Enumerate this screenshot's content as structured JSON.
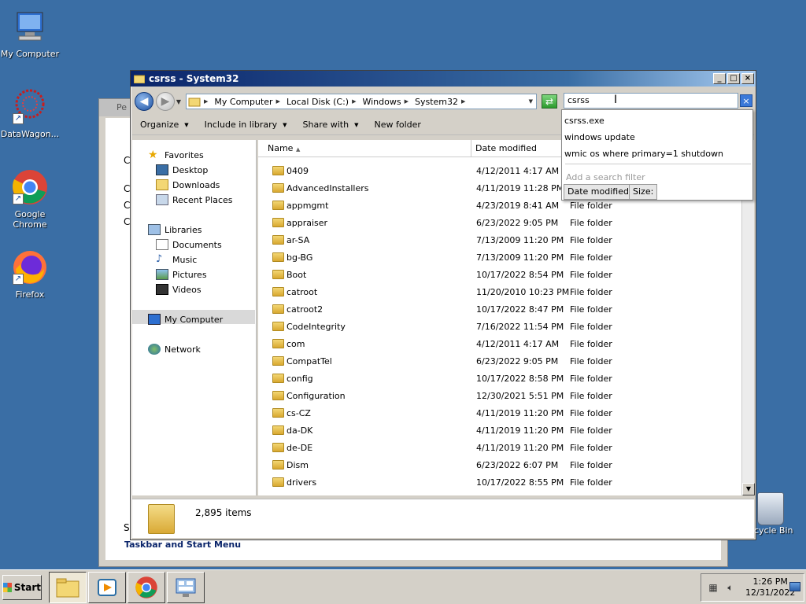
{
  "desktop": {
    "icons": [
      {
        "label": "My Computer"
      },
      {
        "label": "DataWagon..."
      },
      {
        "label": "Google Chrome"
      },
      {
        "label": "Firefox"
      }
    ],
    "recycle_bin_label": "cycle Bin"
  },
  "background_window": {
    "title_fragment": "Pe",
    "link_text": "Taskbar and Start Menu",
    "fragments": [
      "C",
      "C",
      "C",
      "C",
      "S"
    ]
  },
  "window": {
    "title": "csrss - System32",
    "breadcrumb": [
      "My Computer",
      "Local Disk (C:)",
      "Windows",
      "System32"
    ],
    "search": {
      "value": "csrss",
      "suggestions": [
        "csrss.exe",
        "windows update",
        "wmic os where primary=1 shutdown"
      ],
      "filter_placeholder": "Add a search filter",
      "filters": [
        "Date modified:",
        "Size:"
      ]
    },
    "toolbar": {
      "organize": "Organize",
      "include_in_library": "Include in library",
      "share_with": "Share with",
      "new_folder": "New folder"
    },
    "nav": {
      "favorites": "Favorites",
      "favorites_items": [
        "Desktop",
        "Downloads",
        "Recent Places"
      ],
      "libraries": "Libraries",
      "libraries_items": [
        "Documents",
        "Music",
        "Pictures",
        "Videos"
      ],
      "computer": "My Computer",
      "network": "Network"
    },
    "columns": {
      "name": "Name",
      "date": "Date modified"
    },
    "files": [
      {
        "name": "0409",
        "date": "4/12/2011 4:17 AM",
        "type": ""
      },
      {
        "name": "AdvancedInstallers",
        "date": "4/11/2019 11:28 PM",
        "type": ""
      },
      {
        "name": "appmgmt",
        "date": "4/23/2019 8:41 AM",
        "type": "File folder"
      },
      {
        "name": "appraiser",
        "date": "6/23/2022 9:05 PM",
        "type": "File folder"
      },
      {
        "name": "ar-SA",
        "date": "7/13/2009 11:20 PM",
        "type": "File folder"
      },
      {
        "name": "bg-BG",
        "date": "7/13/2009 11:20 PM",
        "type": "File folder"
      },
      {
        "name": "Boot",
        "date": "10/17/2022 8:54 PM",
        "type": "File folder"
      },
      {
        "name": "catroot",
        "date": "11/20/2010 10:23 PM",
        "type": "File folder"
      },
      {
        "name": "catroot2",
        "date": "10/17/2022 8:47 PM",
        "type": "File folder"
      },
      {
        "name": "CodeIntegrity",
        "date": "7/16/2022 11:54 PM",
        "type": "File folder"
      },
      {
        "name": "com",
        "date": "4/12/2011 4:17 AM",
        "type": "File folder"
      },
      {
        "name": "CompatTel",
        "date": "6/23/2022 9:05 PM",
        "type": "File folder"
      },
      {
        "name": "config",
        "date": "10/17/2022 8:58 PM",
        "type": "File folder"
      },
      {
        "name": "Configuration",
        "date": "12/30/2021 5:51 PM",
        "type": "File folder"
      },
      {
        "name": "cs-CZ",
        "date": "4/11/2019 11:20 PM",
        "type": "File folder"
      },
      {
        "name": "da-DK",
        "date": "4/11/2019 11:20 PM",
        "type": "File folder"
      },
      {
        "name": "de-DE",
        "date": "4/11/2019 11:20 PM",
        "type": "File folder"
      },
      {
        "name": "Dism",
        "date": "6/23/2022 6:07 PM",
        "type": "File folder"
      },
      {
        "name": "drivers",
        "date": "10/17/2022 8:55 PM",
        "type": "File folder"
      }
    ],
    "status": {
      "item_count": "2,895 items"
    }
  },
  "taskbar": {
    "start_label": "Start",
    "clock_time": "1:26 PM",
    "clock_date": "12/31/2022"
  }
}
